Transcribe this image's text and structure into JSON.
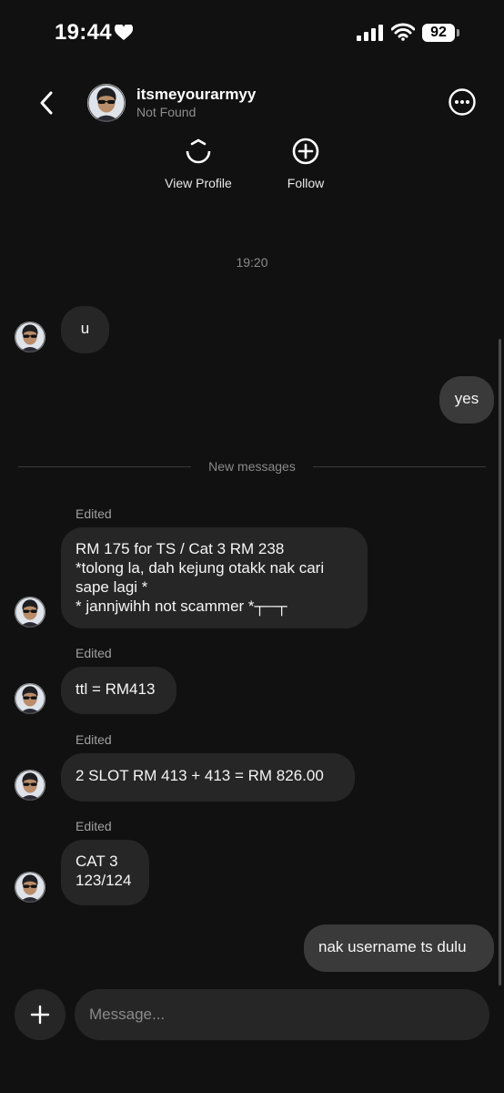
{
  "status": {
    "time": "19:44",
    "battery": "92"
  },
  "header": {
    "username": "itsmeyourarmyy",
    "status": "Not Found"
  },
  "actions": {
    "view_profile": "View Profile",
    "follow": "Follow"
  },
  "chat": {
    "timestamp": "19:20",
    "new_messages": "New messages",
    "edited_label": "Edited",
    "m1": "u",
    "m2": "yes",
    "m3": "RM 175 for TS / Cat 3 RM 238\n*tolong la, dah kejung otakk nak cari sape lagi *\n* jannjwihh not scammer *┬─┬",
    "m4": "ttl = RM413",
    "m5": "2 SLOT RM 413 + 413 = RM 826.00",
    "m6": "CAT 3\n123/124",
    "m7": "nak username ts dulu"
  },
  "composer": {
    "placeholder": "Message..."
  }
}
